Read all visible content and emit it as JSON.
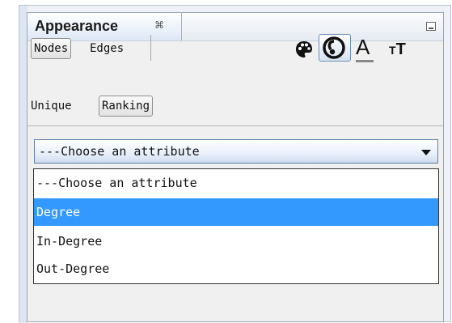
{
  "panel": {
    "tab_title": "Appearance",
    "tab_close_glyph": "⌘",
    "minimize_icon": "minimize-icon"
  },
  "element_tabs": {
    "nodes": "Nodes",
    "edges": "Edges"
  },
  "mode_tabs": {
    "unique": "Unique",
    "ranking": "Ranking"
  },
  "tools": {
    "palette_icon": "palette-icon",
    "size_icon": "size-icon",
    "label_color": "A",
    "label_size_big": "T",
    "label_size_small": "T"
  },
  "combo": {
    "value": "---Choose an attribute"
  },
  "dropdown": {
    "options": [
      "---Choose an attribute",
      "Degree",
      "In-Degree",
      "Out-Degree"
    ],
    "selected_index": 1
  },
  "colors": {
    "selection": "#3399ff",
    "title_bg": "#e6ebf2"
  }
}
